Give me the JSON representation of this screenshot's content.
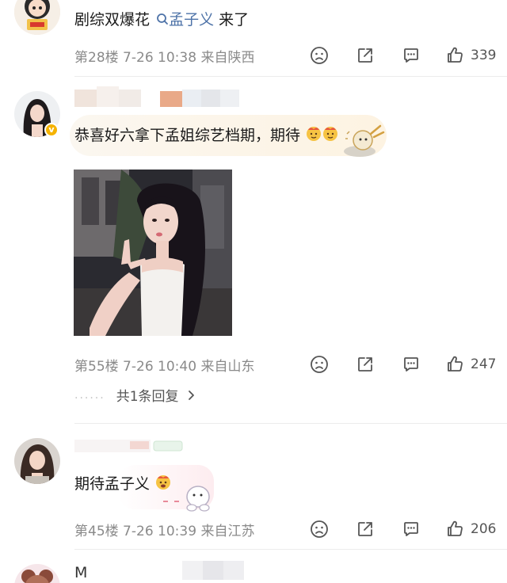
{
  "comments": [
    {
      "text_before": "剧综双爆花",
      "link": "孟子义",
      "text_after": " 来了",
      "floor": "第28楼",
      "date": "7-26",
      "time": "10:38",
      "location": "来自陕西",
      "likes": "339"
    },
    {
      "text": "恭喜好六拿下孟姐综艺档期，期待",
      "floor": "第55楼",
      "date": "7-26",
      "time": "10:40",
      "location": "来自山东",
      "likes": "247",
      "replies": "共1条回复"
    },
    {
      "text": "期待孟子义",
      "floor": "第45楼",
      "date": "7-26",
      "time": "10:39",
      "location": "来自江苏",
      "likes": "206"
    },
    {
      "name_partial": "M"
    }
  ],
  "icons": [
    "dislike-face-icon",
    "share-icon",
    "comment-icon",
    "thumbs-up-icon",
    "search-link-icon",
    "chevron-right-icon",
    "verified-badge-icon"
  ],
  "colors": {
    "link": "#4e73a8",
    "meta": "#8a8a8a",
    "badge": "#f5b301"
  }
}
